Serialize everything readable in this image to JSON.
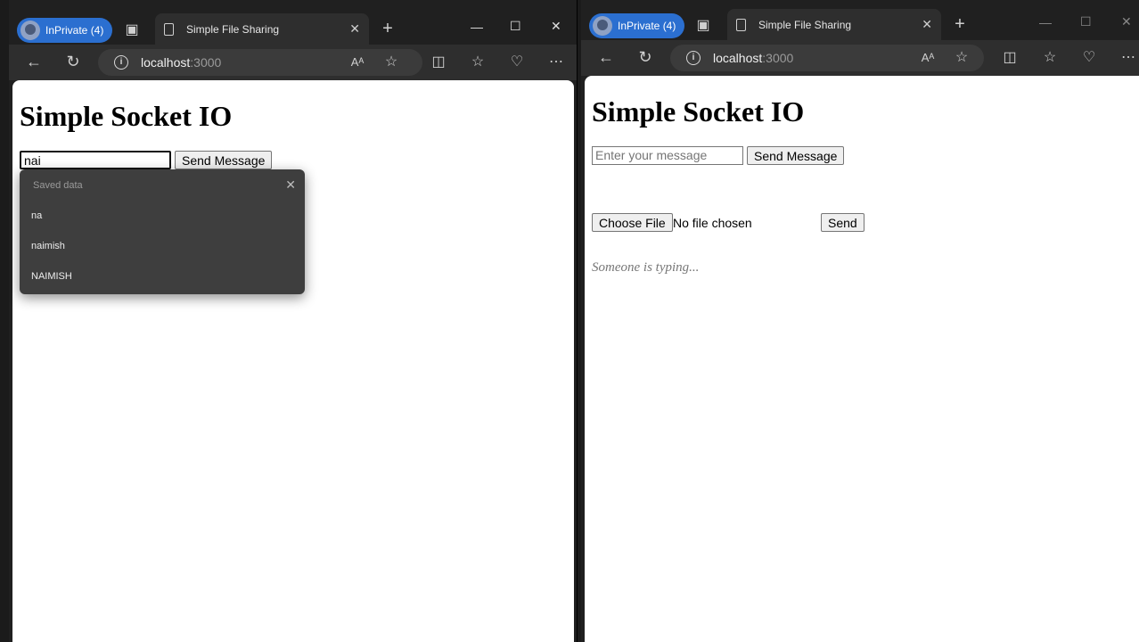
{
  "left": {
    "profile_label": "InPrivate (4)",
    "tab_title": "Simple File Sharing",
    "url_host": "localhost",
    "url_port": ":3000",
    "heading": "Simple Socket IO",
    "message_value": "nai",
    "send_label": "Send Message",
    "autocomplete": {
      "header": "Saved data",
      "items": [
        "na",
        "naimish",
        "NAIMISH"
      ]
    }
  },
  "right": {
    "profile_label": "InPrivate (4)",
    "tab_title": "Simple File Sharing",
    "url_host": "localhost",
    "url_port": ":3000",
    "heading": "Simple Socket IO",
    "message_placeholder": "Enter your message",
    "send_label": "Send Message",
    "choose_file_label": "Choose File",
    "no_file_text": "No file chosen",
    "file_send_label": "Send",
    "typing_text": "Someone is typing..."
  }
}
